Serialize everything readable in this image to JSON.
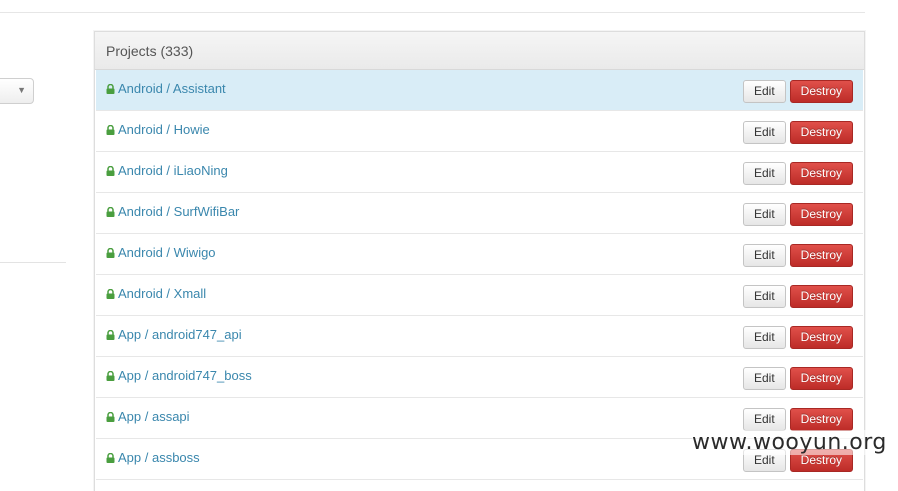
{
  "panel": {
    "title": "Projects (333)"
  },
  "projects": [
    {
      "name": "Android / Assistant",
      "edit_label": "Edit",
      "destroy_label": "Destroy",
      "highlighted": true
    },
    {
      "name": "Android / Howie",
      "edit_label": "Edit",
      "destroy_label": "Destroy"
    },
    {
      "name": "Android / iLiaoNing",
      "edit_label": "Edit",
      "destroy_label": "Destroy"
    },
    {
      "name": "Android / SurfWifiBar",
      "edit_label": "Edit",
      "destroy_label": "Destroy"
    },
    {
      "name": "Android / Wiwigo",
      "edit_label": "Edit",
      "destroy_label": "Destroy"
    },
    {
      "name": "Android / Xmall",
      "edit_label": "Edit",
      "destroy_label": "Destroy"
    },
    {
      "name": "App / android747_api",
      "edit_label": "Edit",
      "destroy_label": "Destroy"
    },
    {
      "name": "App / android747_boss",
      "edit_label": "Edit",
      "destroy_label": "Destroy"
    },
    {
      "name": "App / assapi",
      "edit_label": "Edit",
      "destroy_label": "Destroy"
    },
    {
      "name": "App / assboss",
      "edit_label": "Edit",
      "destroy_label": "Destroy"
    }
  ],
  "icons": {
    "project_private": "lock-icon",
    "select_caret": "chevron-down-icon"
  },
  "colors": {
    "link": "#3a87ad",
    "lock": "#4a9e3f",
    "highlight_row": "#d9edf7",
    "destroy_button": "#d2322d"
  },
  "watermark": "www.wooyun.org"
}
